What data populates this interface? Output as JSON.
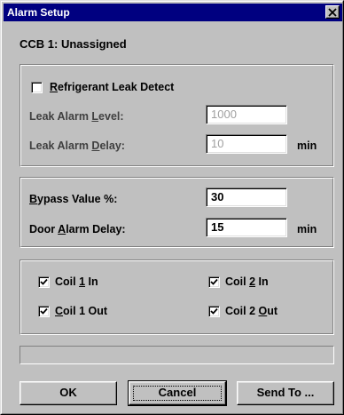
{
  "window": {
    "title": "Alarm Setup"
  },
  "header": {
    "subtitle": "CCB 1: Unassigned"
  },
  "leak": {
    "checkbox_label": "Refrigerant Leak Detect",
    "checked": false,
    "level_label": "Leak Alarm Level:",
    "level_value": "1000",
    "delay_label": "Leak Alarm Delay:",
    "delay_value": "10",
    "delay_unit": "min"
  },
  "settings": {
    "bypass_label": "Bypass Value %:",
    "bypass_value": "30",
    "door_label": "Door Alarm Delay:",
    "door_value": "15",
    "door_unit": "min"
  },
  "coils": [
    {
      "label": "Coil 1 In",
      "checked": true
    },
    {
      "label": "Coil 2 In",
      "checked": true
    },
    {
      "label": "Coil 1 Out",
      "checked": true
    },
    {
      "label": "Coil 2 Out",
      "checked": true
    }
  ],
  "status": {
    "text": ""
  },
  "buttons": {
    "ok": "OK",
    "cancel": "Cancel",
    "send_to": "Send To ..."
  },
  "icons": {
    "close": "close-icon",
    "checkmark": "checkmark-icon"
  },
  "colors": {
    "titlebar": "#000080",
    "face": "#c0c0c0",
    "disabled_text": "#a0a0a0"
  }
}
